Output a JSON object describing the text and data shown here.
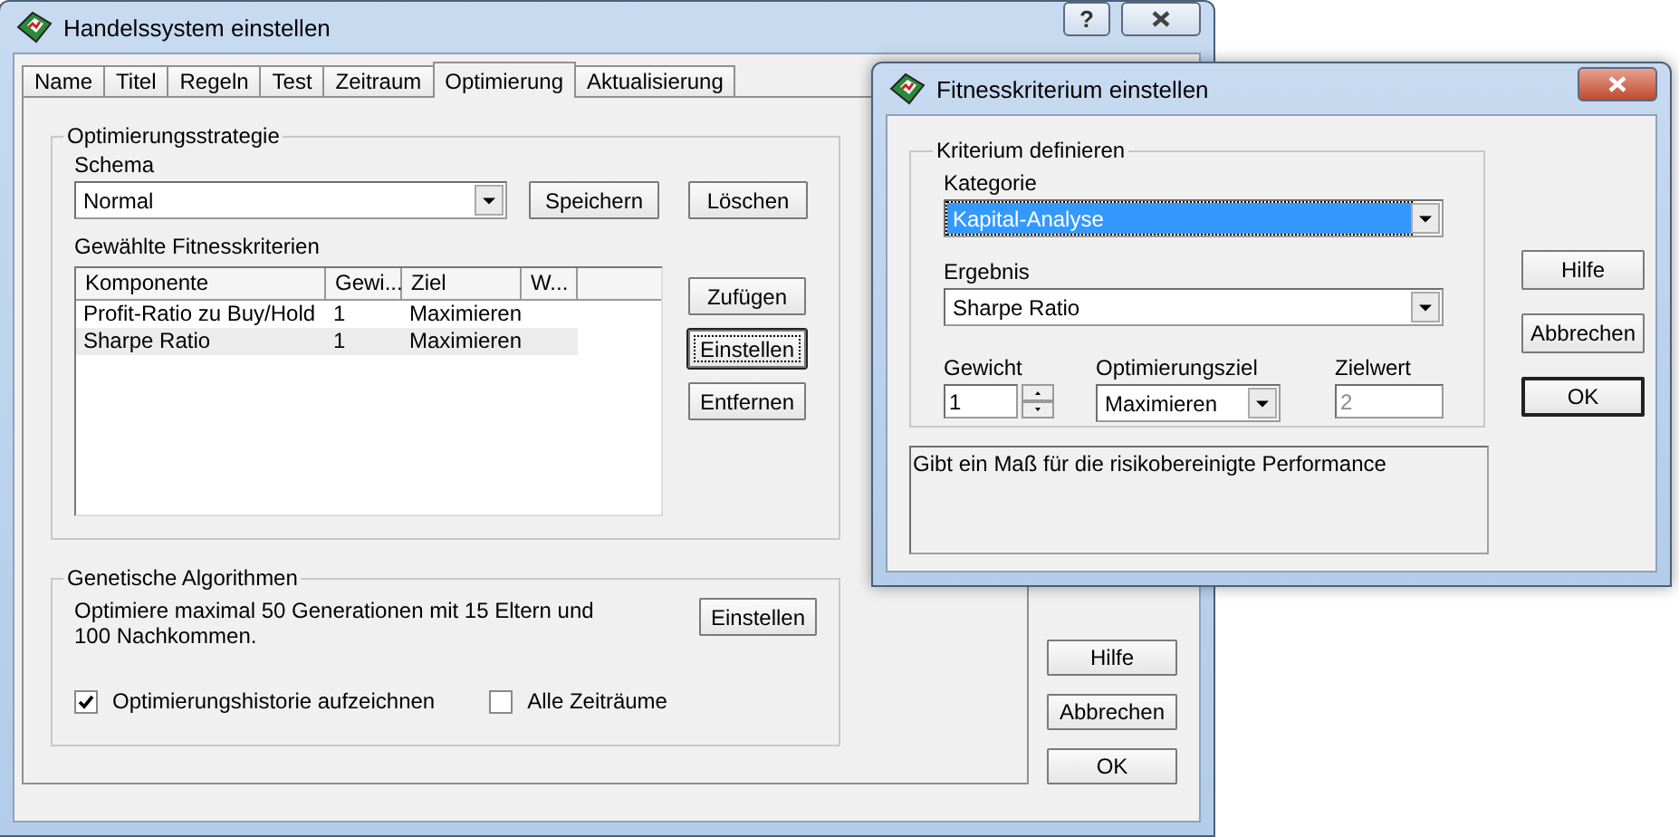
{
  "main_window": {
    "title": "Handelssystem einstellen",
    "help_button": "?",
    "tabs": [
      {
        "label": "Name",
        "selected": false
      },
      {
        "label": "Titel",
        "selected": false
      },
      {
        "label": "Regeln",
        "selected": false
      },
      {
        "label": "Test",
        "selected": false
      },
      {
        "label": "Zeitraum",
        "selected": false
      },
      {
        "label": "Optimierung",
        "selected": true
      },
      {
        "label": "Aktualisierung",
        "selected": false
      }
    ],
    "strategy_group": {
      "title": "Optimierungsstrategie",
      "schema_label": "Schema",
      "schema_value": "Normal",
      "schema_buttons": [
        "Speichern",
        "Löschen"
      ],
      "criteria_label": "Gewählte Fitnesskriterien",
      "columns": [
        "Komponente",
        "Gewi...",
        "Ziel",
        "W..."
      ],
      "rows": [
        {
          "cells": [
            "Profit-Ratio zu Buy/Hold",
            "1",
            "Maximieren"
          ],
          "selected": false
        },
        {
          "cells": [
            "Sharpe Ratio",
            "1",
            "Maximieren"
          ],
          "selected": true
        }
      ],
      "side_buttons": [
        {
          "label": "Zufügen",
          "focused": false
        },
        {
          "label": "Einstellen",
          "focused": true
        },
        {
          "label": "Entfernen",
          "focused": false
        }
      ]
    },
    "genetic_group": {
      "title": "Genetische Algorithmen",
      "description": "Optimiere maximal 50 Generationen mit 15 Eltern und 100 Nachkommen.",
      "button": "Einstellen",
      "checkboxes": [
        {
          "label": "Optimierungshistorie aufzeichnen",
          "checked": true
        },
        {
          "label": "Alle Zeiträume",
          "checked": false
        }
      ]
    },
    "buttons": [
      "Hilfe",
      "Abbrechen",
      "OK"
    ]
  },
  "dialog": {
    "title": "Fitnesskriterium einstellen",
    "group_title": "Kriterium definieren",
    "kategorie": {
      "label": "Kategorie",
      "value": "Kapital-Analyse",
      "highlighted": true
    },
    "ergebnis": {
      "label": "Ergebnis",
      "value": "Sharpe Ratio",
      "highlighted": false
    },
    "gewicht": {
      "label": "Gewicht",
      "value": "1"
    },
    "optimierungsziel": {
      "label": "Optimierungsziel",
      "value": "Maximieren"
    },
    "zielwert": {
      "label": "Zielwert",
      "value": "2",
      "disabled": true
    },
    "description": "Gibt ein Maß für die risikobereinigte Performance",
    "buttons": [
      {
        "label": "Hilfe",
        "default": false
      },
      {
        "label": "Abbrechen",
        "default": false
      },
      {
        "label": "OK",
        "default": true
      }
    ]
  }
}
